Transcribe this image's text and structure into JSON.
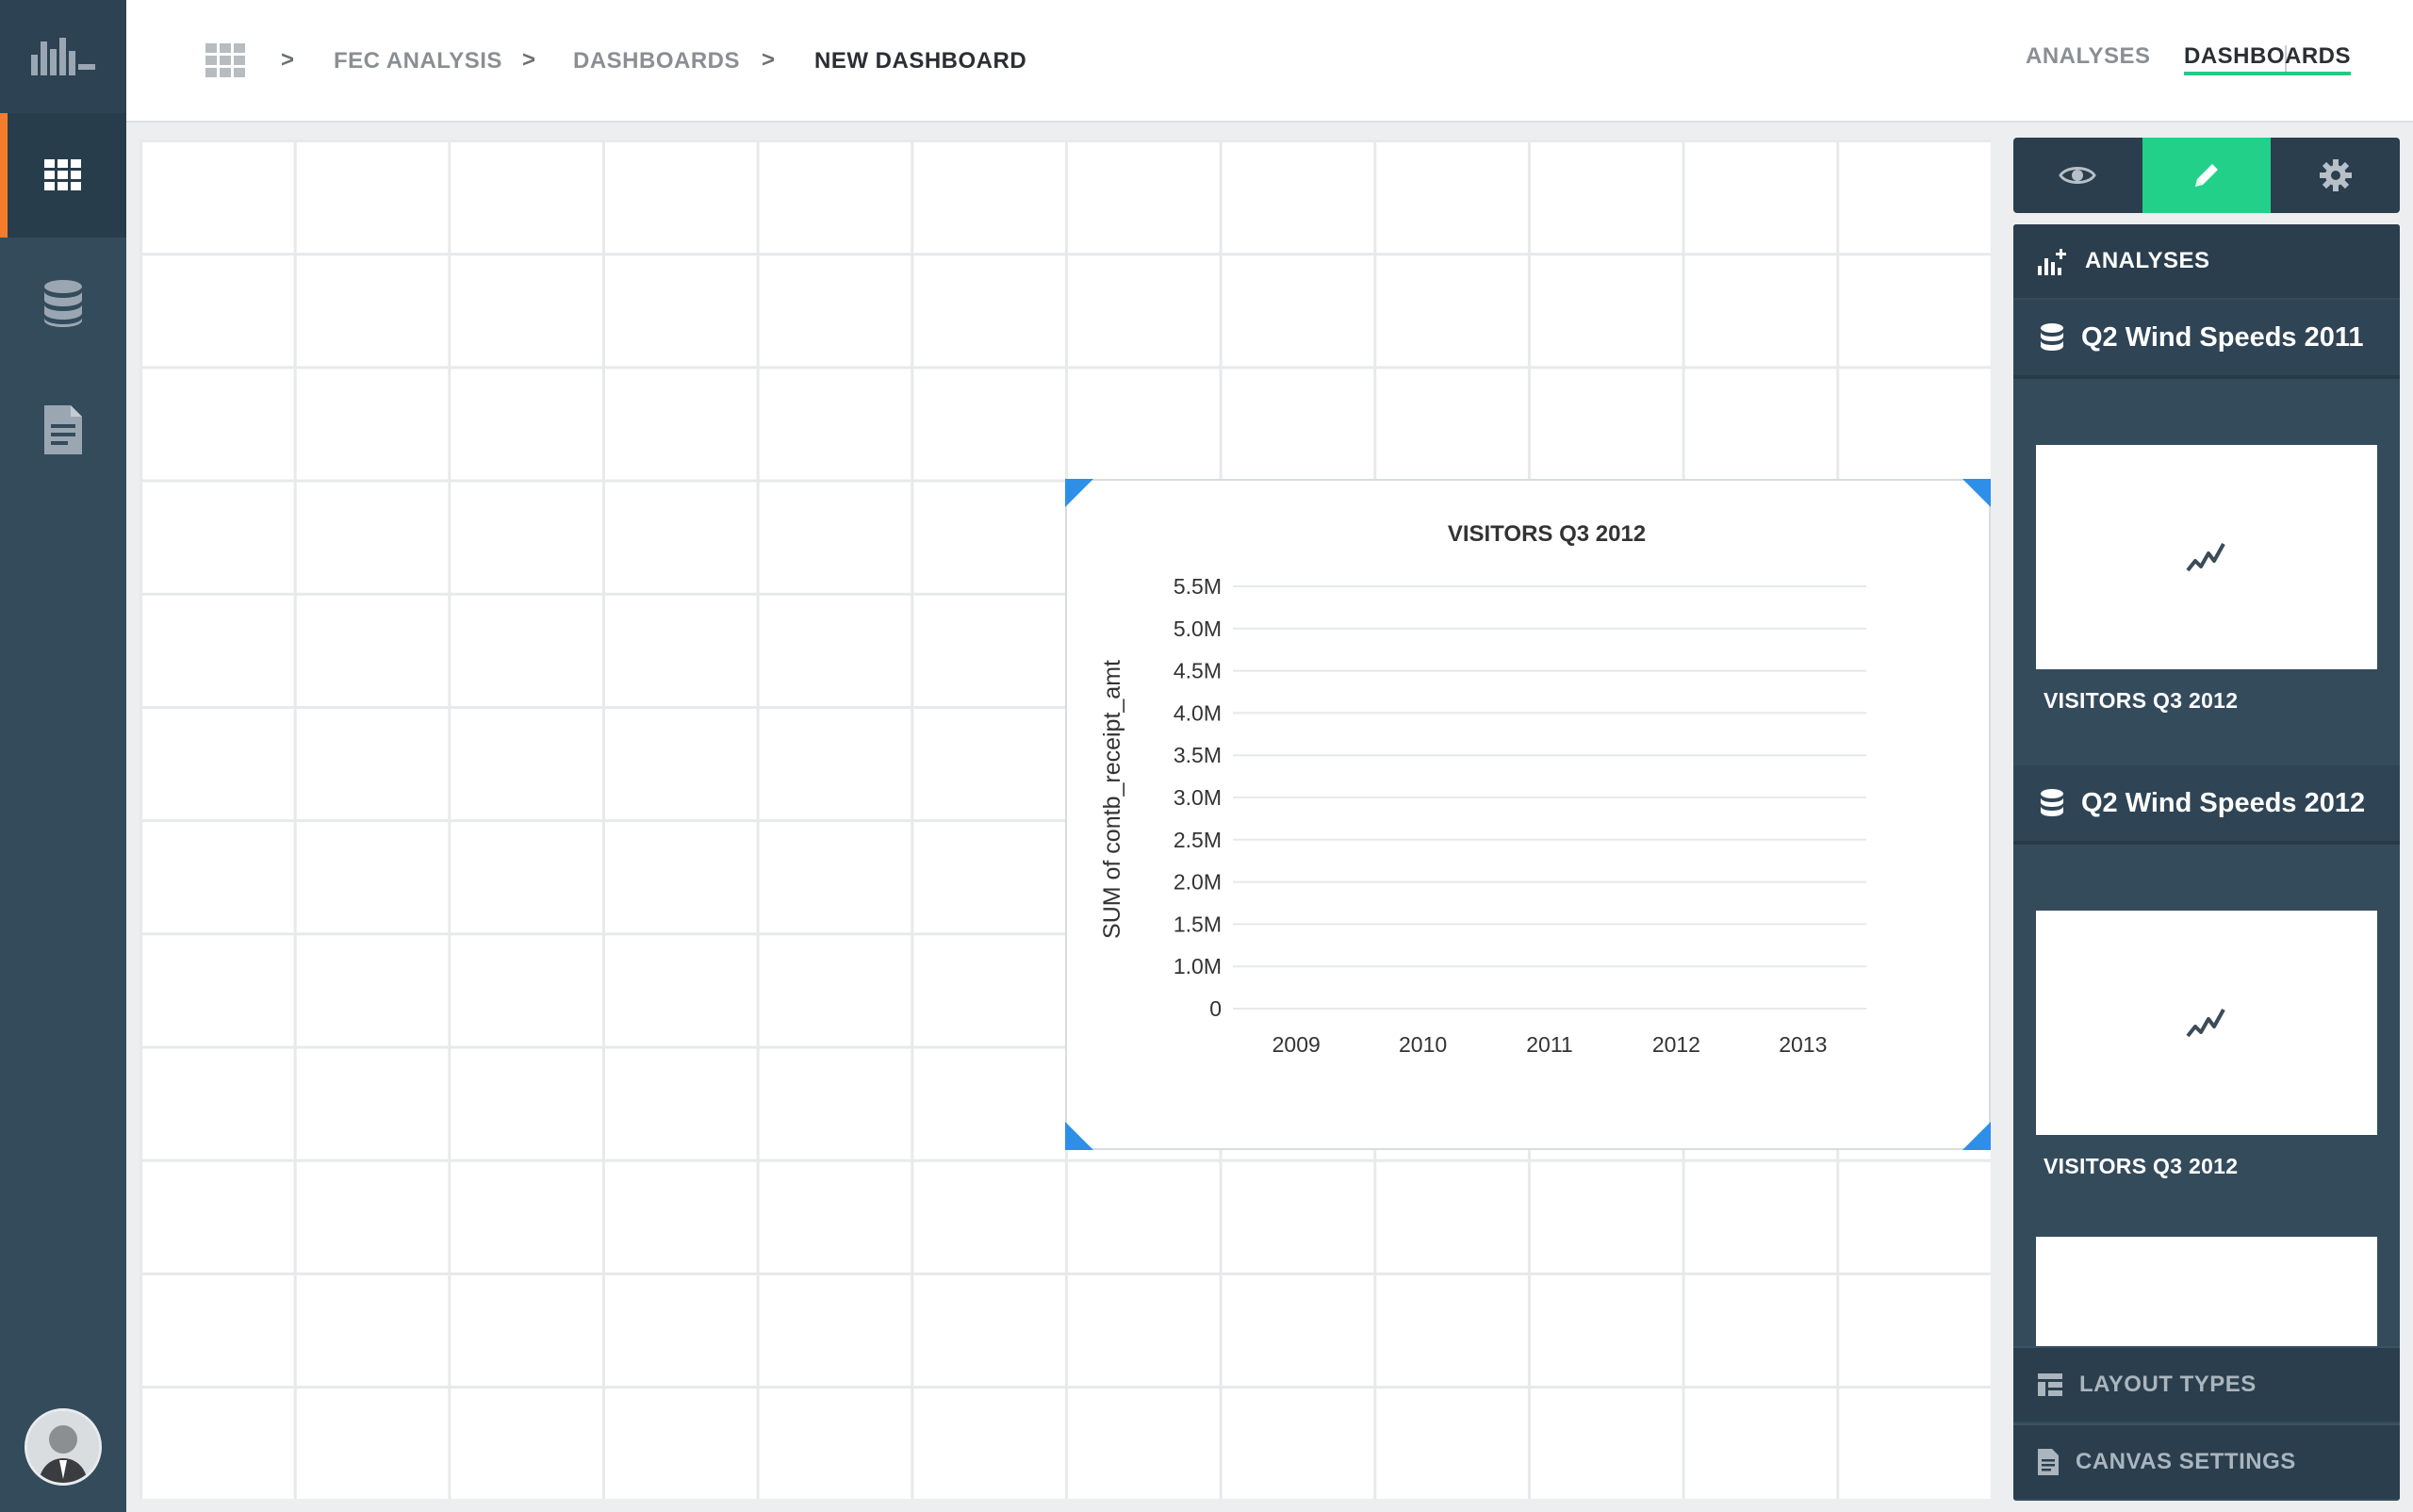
{
  "breadcrumb": {
    "items": [
      "FEC ANALYSIS",
      "DASHBOARDS",
      "NEW DASHBOARD"
    ],
    "separator": ">"
  },
  "top_nav": {
    "analyses": "ANALYSES",
    "divider": "|",
    "dashboards": "DASHBOARDS"
  },
  "right_panel": {
    "analyses_header": "ANALYSES",
    "groups": [
      {
        "title": "Q2 Wind Speeds 2011",
        "thumbnail_label": "VISITORS Q3 2012"
      },
      {
        "title": "Q2 Wind Speeds 2012",
        "thumbnail_label": "VISITORS Q3 2012"
      }
    ],
    "layout_types": "LAYOUT TYPES",
    "canvas_settings": "CANVAS SETTINGS"
  },
  "colors": {
    "accent_orange": "#f57c2a",
    "accent_green": "#22d08a",
    "handle_blue": "#2e8fe8",
    "nav_bg": "#344b5c"
  },
  "chart_data": {
    "type": "line",
    "title": "VISITORS Q3 2012",
    "xlabel": "",
    "ylabel": "SUM of contb_receipt_amt",
    "categories": [
      "2009",
      "2010",
      "2011",
      "2012",
      "2013"
    ],
    "y_ticks": [
      "0",
      "1.0M",
      "1.5M",
      "2.0M",
      "2.5M",
      "3.0M",
      "3.5M",
      "4.0M",
      "4.5M",
      "5.0M",
      "5.5M"
    ],
    "series": [],
    "grid": true
  }
}
